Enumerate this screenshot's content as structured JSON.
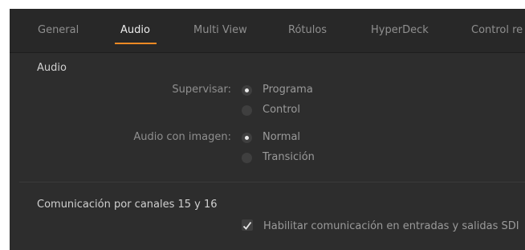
{
  "tabs": [
    {
      "label": "General"
    },
    {
      "label": "Audio"
    },
    {
      "label": "Multi View"
    },
    {
      "label": "Rótulos"
    },
    {
      "label": "HyperDeck"
    },
    {
      "label": "Control re"
    }
  ],
  "active_tab": "Audio",
  "audio_section": {
    "title": "Audio",
    "monitor": {
      "label": "Supervisar:",
      "options": [
        "Programa",
        "Control"
      ],
      "selected": "Programa"
    },
    "audio_follow_video": {
      "label": "Audio con imagen:",
      "options": [
        "Normal",
        "Transición"
      ],
      "selected": "Normal"
    }
  },
  "talkback_section": {
    "title": "Comunicación por canales 15 y 16",
    "checkbox_label": "Habilitar comunicación en entradas y salidas SDI",
    "checked": true
  },
  "colors": {
    "accent": "#f08a24",
    "panel_bg": "#2d2d2d"
  }
}
